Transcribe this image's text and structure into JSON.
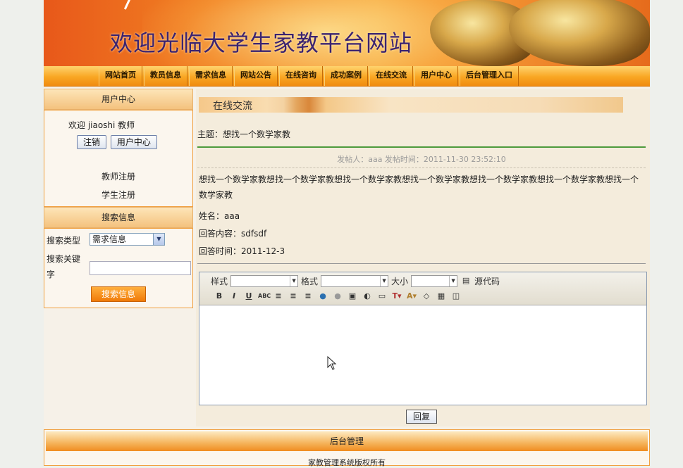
{
  "header": {
    "title": "欢迎光临大学生家教平台网站"
  },
  "nav": {
    "items": [
      "网站首页",
      "教员信息",
      "需求信息",
      "网站公告",
      "在线咨询",
      "成功案例",
      "在线交流",
      "用户中心",
      "后台管理入口"
    ]
  },
  "sidebar": {
    "user_center_title": "用户中心",
    "welcome_text": "欢迎 jiaoshi 教师",
    "logout_label": "注销",
    "user_center_button": "用户中心",
    "teacher_register": "教师注册",
    "student_register": "学生注册",
    "search_title": "搜索信息",
    "search_type_label": "搜索类型",
    "search_type_value": "需求信息",
    "keyword_label": "搜索关键字",
    "search_button": "搜索信息"
  },
  "main": {
    "section_title": "在线交流",
    "topic": "主题：想找一个数学家教",
    "post_meta": "发帖人：aaa 发帖时间：2011-11-30 23:52:10",
    "content": "想找一个数学家教想找一个数学家教想找一个数学家教想找一个数学家教想找一个数学家教想找一个数学家教想找一个数学家教",
    "name_line": "姓名：aaa",
    "reply_content_line": "回答内容：sdfsdf",
    "reply_time_line": "回答时间：2011-12-3",
    "editor": {
      "style_label": "样式",
      "format_label": "格式",
      "size_label": "大小",
      "source_label": "源代码"
    },
    "reply_button": "回复"
  },
  "footer": {
    "title": "后台管理",
    "copyright": "家教管理系统版权所有"
  }
}
